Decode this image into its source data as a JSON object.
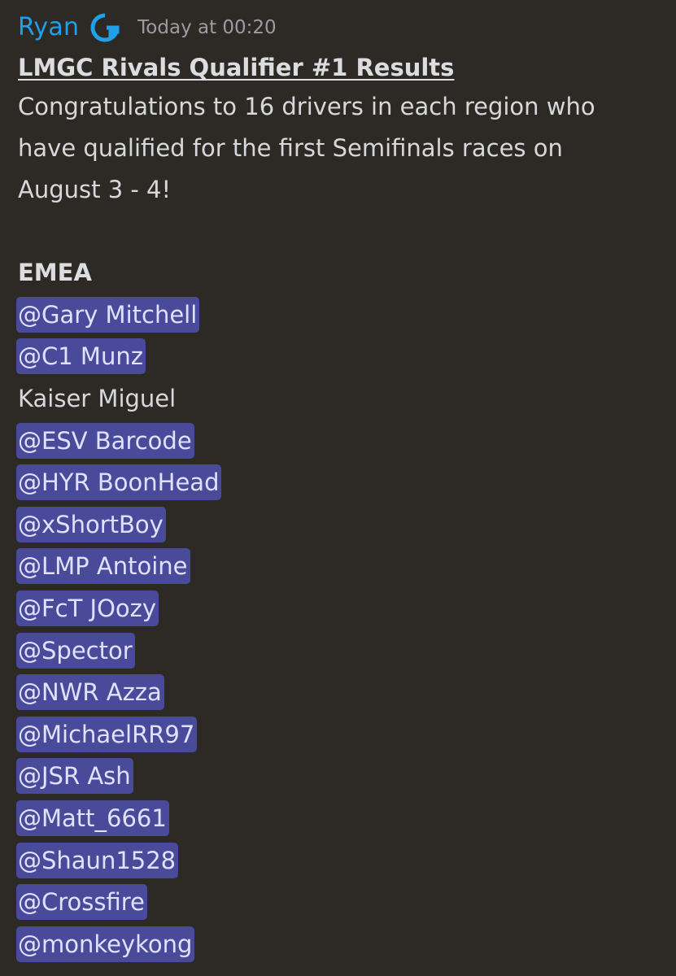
{
  "message": {
    "author": "Ryan",
    "author_color": "#1fa0e8",
    "role_icon": "logitech-g-icon",
    "timestamp": "Today at 00:20",
    "title": "LMGC Rivals Qualifier #1 Results",
    "intro_lines": [
      "Congratulations to 16 drivers in each region who",
      "have qualified for the first Semifinals races on",
      "August 3 - 4!"
    ],
    "region": "EMEA",
    "mention_bg": "#4a4a9b",
    "entries": [
      {
        "text": "@Gary Mitchell",
        "mention": true
      },
      {
        "text": "@C1 Munz",
        "mention": true
      },
      {
        "text": "Kaiser Miguel",
        "mention": false
      },
      {
        "text": "@ESV Barcode",
        "mention": true
      },
      {
        "text": "@HYR BoonHead",
        "mention": true
      },
      {
        "text": "@xShortBoy",
        "mention": true
      },
      {
        "text": "@LMP Antoine",
        "mention": true
      },
      {
        "text": "@FcT JOozy",
        "mention": true
      },
      {
        "text": "@Spector",
        "mention": true
      },
      {
        "text": "@NWR Azza",
        "mention": true
      },
      {
        "text": "@MichaelRR97",
        "mention": true
      },
      {
        "text": "@JSR Ash",
        "mention": true
      },
      {
        "text": "@Matt_6661",
        "mention": true
      },
      {
        "text": "@Shaun1528",
        "mention": true
      },
      {
        "text": "@Crossfire",
        "mention": true
      },
      {
        "text": "@monkeykong",
        "mention": true
      }
    ]
  }
}
